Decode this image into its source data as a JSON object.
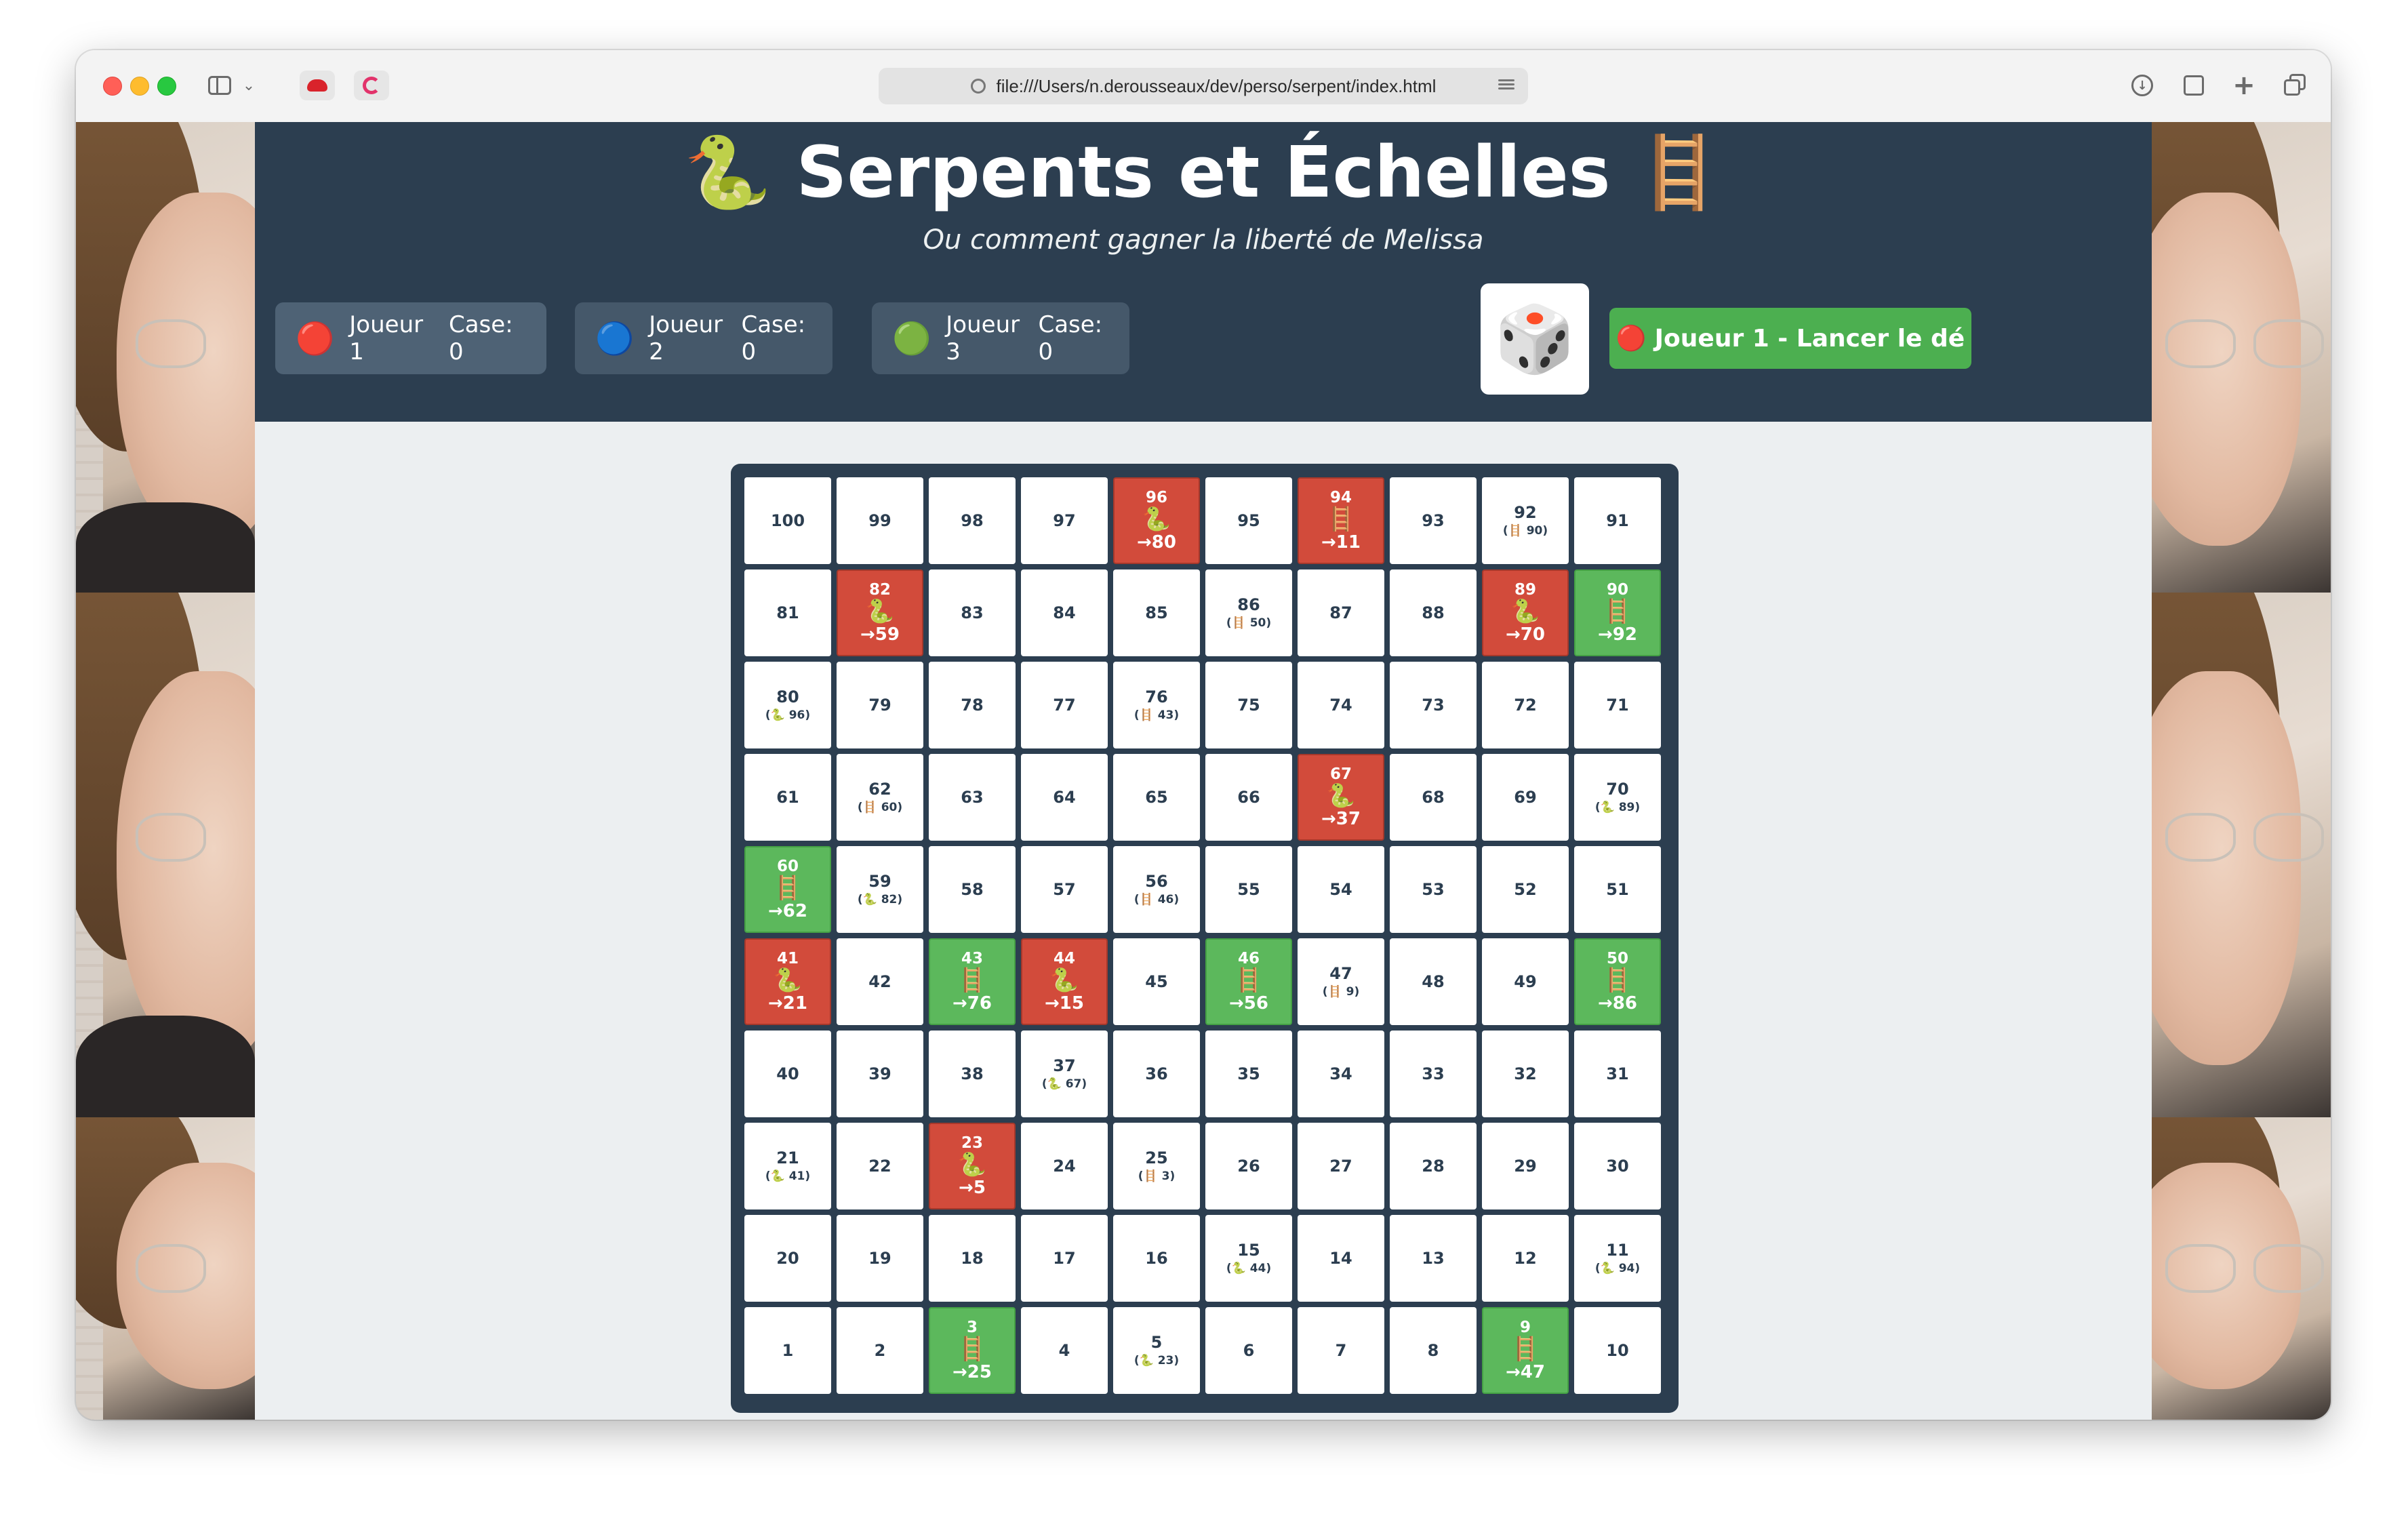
{
  "browser": {
    "url": "file:///Users/n.derousseaux/dev/perso/serpent/index.html",
    "icons": [
      "sidebar-icon",
      "chevron-down-icon",
      "redhat-extension-icon",
      "c-extension-icon",
      "download-icon",
      "share-icon",
      "new-tab-icon",
      "tab-overview-icon"
    ]
  },
  "header": {
    "title": "🐍 Serpents et Échelles 🪜",
    "subtitle": "Ou comment gagner la liberté de Melissa"
  },
  "players": [
    {
      "token": "🔴",
      "name": "Joueur 1",
      "case": "Case: 0",
      "color": "#e53935"
    },
    {
      "token": "🔵",
      "name": "Joueur 2",
      "case": "Case: 0",
      "color": "#1e5bd6"
    },
    {
      "token": "🟢",
      "name": "Joueur 3",
      "case": "Case: 0",
      "color": "#43a047"
    }
  ],
  "dice": {
    "face": "🎲"
  },
  "roll_button": {
    "ball": "🔴",
    "label": "Joueur 1 - Lancer le dé"
  },
  "colors": {
    "header": "#2c3e50",
    "snake": "#d24b3b",
    "ladder": "#5cb85c",
    "button": "#4caf50"
  },
  "board": {
    "rows": [
      [
        {
          "n": "100"
        },
        {
          "n": "99"
        },
        {
          "n": "98"
        },
        {
          "n": "97"
        },
        {
          "n": "96",
          "type": "snake",
          "icon": "🐍",
          "to": "→80"
        },
        {
          "n": "95"
        },
        {
          "n": "94",
          "type": "ladder",
          "icon": "🪜",
          "to": "→11",
          "hl": "snake"
        },
        {
          "n": "93"
        },
        {
          "n": "92",
          "hint": "(🪜 90)"
        },
        {
          "n": "91"
        }
      ],
      [
        {
          "n": "81"
        },
        {
          "n": "82",
          "type": "snake",
          "icon": "🐍",
          "to": "→59"
        },
        {
          "n": "83"
        },
        {
          "n": "84"
        },
        {
          "n": "85"
        },
        {
          "n": "86",
          "hint": "(🪜 50)"
        },
        {
          "n": "87"
        },
        {
          "n": "88"
        },
        {
          "n": "89",
          "type": "snake",
          "icon": "🐍",
          "to": "→70"
        },
        {
          "n": "90",
          "type": "ladder",
          "icon": "🪜",
          "to": "→92"
        }
      ],
      [
        {
          "n": "80",
          "hint": "(🐍 96)"
        },
        {
          "n": "79"
        },
        {
          "n": "78"
        },
        {
          "n": "77"
        },
        {
          "n": "76",
          "hint": "(🪜 43)"
        },
        {
          "n": "75"
        },
        {
          "n": "74"
        },
        {
          "n": "73"
        },
        {
          "n": "72"
        },
        {
          "n": "71"
        }
      ],
      [
        {
          "n": "61"
        },
        {
          "n": "62",
          "hint": "(🪜 60)"
        },
        {
          "n": "63"
        },
        {
          "n": "64"
        },
        {
          "n": "65"
        },
        {
          "n": "66"
        },
        {
          "n": "67",
          "type": "snake",
          "icon": "🐍",
          "to": "→37"
        },
        {
          "n": "68"
        },
        {
          "n": "69"
        },
        {
          "n": "70",
          "hint": "(🐍 89)"
        }
      ],
      [
        {
          "n": "60",
          "type": "ladder",
          "icon": "🪜",
          "to": "→62"
        },
        {
          "n": "59",
          "hint": "(🐍 82)"
        },
        {
          "n": "58"
        },
        {
          "n": "57"
        },
        {
          "n": "56",
          "hint": "(🪜 46)"
        },
        {
          "n": "55"
        },
        {
          "n": "54"
        },
        {
          "n": "53"
        },
        {
          "n": "52"
        },
        {
          "n": "51"
        }
      ],
      [
        {
          "n": "41",
          "type": "snake",
          "icon": "🐍",
          "to": "→21"
        },
        {
          "n": "42"
        },
        {
          "n": "43",
          "type": "ladder",
          "icon": "🪜",
          "to": "→76"
        },
        {
          "n": "44",
          "type": "snake",
          "icon": "🐍",
          "to": "→15"
        },
        {
          "n": "45"
        },
        {
          "n": "46",
          "type": "ladder",
          "icon": "🪜",
          "to": "→56"
        },
        {
          "n": "47",
          "hint": "(🪜 9)"
        },
        {
          "n": "48"
        },
        {
          "n": "49"
        },
        {
          "n": "50",
          "type": "ladder",
          "icon": "🪜",
          "to": "→86"
        }
      ],
      [
        {
          "n": "40"
        },
        {
          "n": "39"
        },
        {
          "n": "38"
        },
        {
          "n": "37",
          "hint": "(🐍 67)"
        },
        {
          "n": "36"
        },
        {
          "n": "35"
        },
        {
          "n": "34"
        },
        {
          "n": "33"
        },
        {
          "n": "32"
        },
        {
          "n": "31"
        }
      ],
      [
        {
          "n": "21",
          "hint": "(🐍 41)"
        },
        {
          "n": "22"
        },
        {
          "n": "23",
          "type": "snake",
          "icon": "🐍",
          "to": "→5"
        },
        {
          "n": "24"
        },
        {
          "n": "25",
          "hint": "(🪜 3)"
        },
        {
          "n": "26"
        },
        {
          "n": "27"
        },
        {
          "n": "28"
        },
        {
          "n": "29"
        },
        {
          "n": "30"
        }
      ],
      [
        {
          "n": "20"
        },
        {
          "n": "19"
        },
        {
          "n": "18"
        },
        {
          "n": "17"
        },
        {
          "n": "16"
        },
        {
          "n": "15",
          "hint": "(🐍 44)"
        },
        {
          "n": "14"
        },
        {
          "n": "13"
        },
        {
          "n": "12"
        },
        {
          "n": "11",
          "hint": "(🐍 94)"
        }
      ],
      [
        {
          "n": "1"
        },
        {
          "n": "2"
        },
        {
          "n": "3",
          "type": "ladder",
          "icon": "🪜",
          "to": "→25"
        },
        {
          "n": "4"
        },
        {
          "n": "5",
          "hint": "(🐍 23)"
        },
        {
          "n": "6"
        },
        {
          "n": "7"
        },
        {
          "n": "8"
        },
        {
          "n": "9",
          "type": "ladder",
          "icon": "🪜",
          "to": "→47"
        },
        {
          "n": "10"
        }
      ]
    ]
  }
}
